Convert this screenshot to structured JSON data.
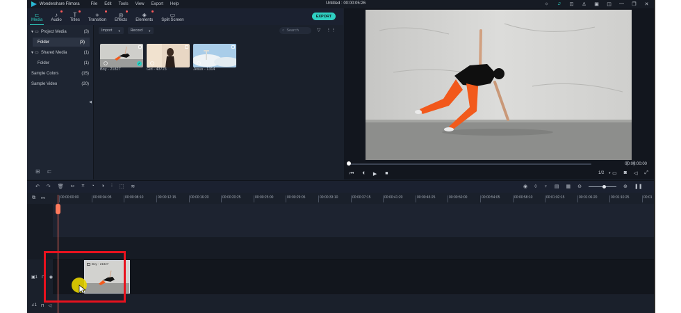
{
  "app": {
    "name": "Wondershare Filmora",
    "menu": [
      "File",
      "Edit",
      "Tools",
      "View",
      "Export",
      "Help"
    ],
    "window_title": "Untitled : 00:00:05:26",
    "accent": "#2fd0c2"
  },
  "toolbar": {
    "tabs": [
      {
        "label": "Media",
        "icon": "folder-icon",
        "active": true
      },
      {
        "label": "Audio",
        "icon": "music-icon"
      },
      {
        "label": "Titles",
        "icon": "text-icon"
      },
      {
        "label": "Transition",
        "icon": "transition-icon"
      },
      {
        "label": "Effects",
        "icon": "effects-icon"
      },
      {
        "label": "Elements",
        "icon": "elements-icon"
      },
      {
        "label": "Split Screen",
        "icon": "split-screen-icon"
      }
    ],
    "export_label": "EXPORT"
  },
  "media_tree": {
    "items": [
      {
        "label": "Project Media",
        "count": "(3)"
      },
      {
        "label": "Folder",
        "count": "(3)",
        "selected": true
      },
      {
        "label": "Shared Media",
        "count": "(1)"
      },
      {
        "label": "Folder",
        "count": "(1)"
      },
      {
        "label": "Sample Colors",
        "count": "(15)"
      },
      {
        "label": "Sample Video",
        "count": "(20)"
      }
    ]
  },
  "media_grid": {
    "import_label": "Import",
    "record_label": "Record",
    "search_placeholder": "Search",
    "items": [
      {
        "label": "Boy - 21827"
      },
      {
        "label": "Girl - 43723"
      },
      {
        "label": "Jesus - 1314"
      }
    ]
  },
  "preview": {
    "timecode": "00:00:00:00",
    "ratio": "1/2"
  },
  "timeline": {
    "ruler": [
      "00:00:00:00",
      "00:00:04:05",
      "00:00:08:10",
      "00:00:12:15",
      "00:00:16:20",
      "00:00:20:25",
      "00:00:25:00",
      "00:00:29:05",
      "00:00:33:10",
      "00:00:37:15",
      "00:00:41:20",
      "00:00:45:25",
      "00:00:50:00",
      "00:00:54:05",
      "00:00:58:10",
      "00:01:02:15",
      "00:01:06:20",
      "00:01:10:25",
      "00:01"
    ],
    "video_track_label": "1",
    "audio_track_label": "1",
    "clip_label": "Boy - 21827"
  }
}
